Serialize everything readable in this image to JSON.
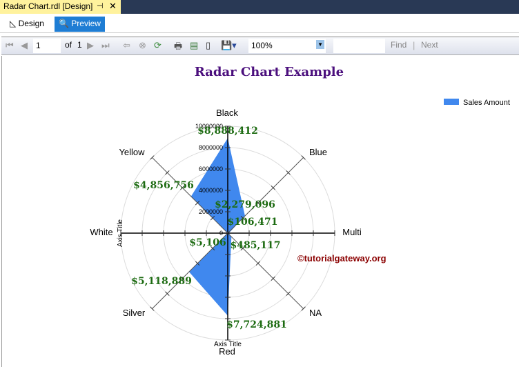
{
  "tab": {
    "title": "Radar Chart.rdl [Design]",
    "pin": "⊣",
    "close": "✕"
  },
  "mode": {
    "design": "Design",
    "preview": "Preview"
  },
  "toolbar": {
    "page": "1",
    "of": "of",
    "total": "1",
    "zoom": "100%",
    "find": "Find",
    "next": "Next"
  },
  "watermark": "©tutorialgateway.org",
  "chart_data": {
    "type": "radar",
    "title": "Radar Chart Example",
    "categories": [
      "Black",
      "Blue",
      "Multi",
      "NA",
      "Red",
      "Silver",
      "White",
      "Yellow"
    ],
    "series": [
      {
        "name": "Sales Amount",
        "values": [
          8888412,
          2279096,
          106471,
          485117,
          7724881,
          5118889,
          5106,
          4856756
        ],
        "color": "#4088ee"
      }
    ],
    "data_labels": [
      "$8,888,412",
      "$2,279,096",
      "$106,471",
      "$485,117",
      "$7,724,881",
      "$5,118,889",
      "$5,106",
      "$4,856,756"
    ],
    "ylim": [
      0,
      10000000
    ],
    "yticks": [
      "0",
      "2000000",
      "4000000",
      "6000000",
      "8000000",
      "10000000"
    ],
    "xlabel": "Axis Title",
    "ylabel": "Axis Title",
    "legend": "top-right",
    "grid": true,
    "colors": {
      "title": "#4b0f7d",
      "label": "#1d6b12",
      "watermark": "#8b0000"
    }
  }
}
